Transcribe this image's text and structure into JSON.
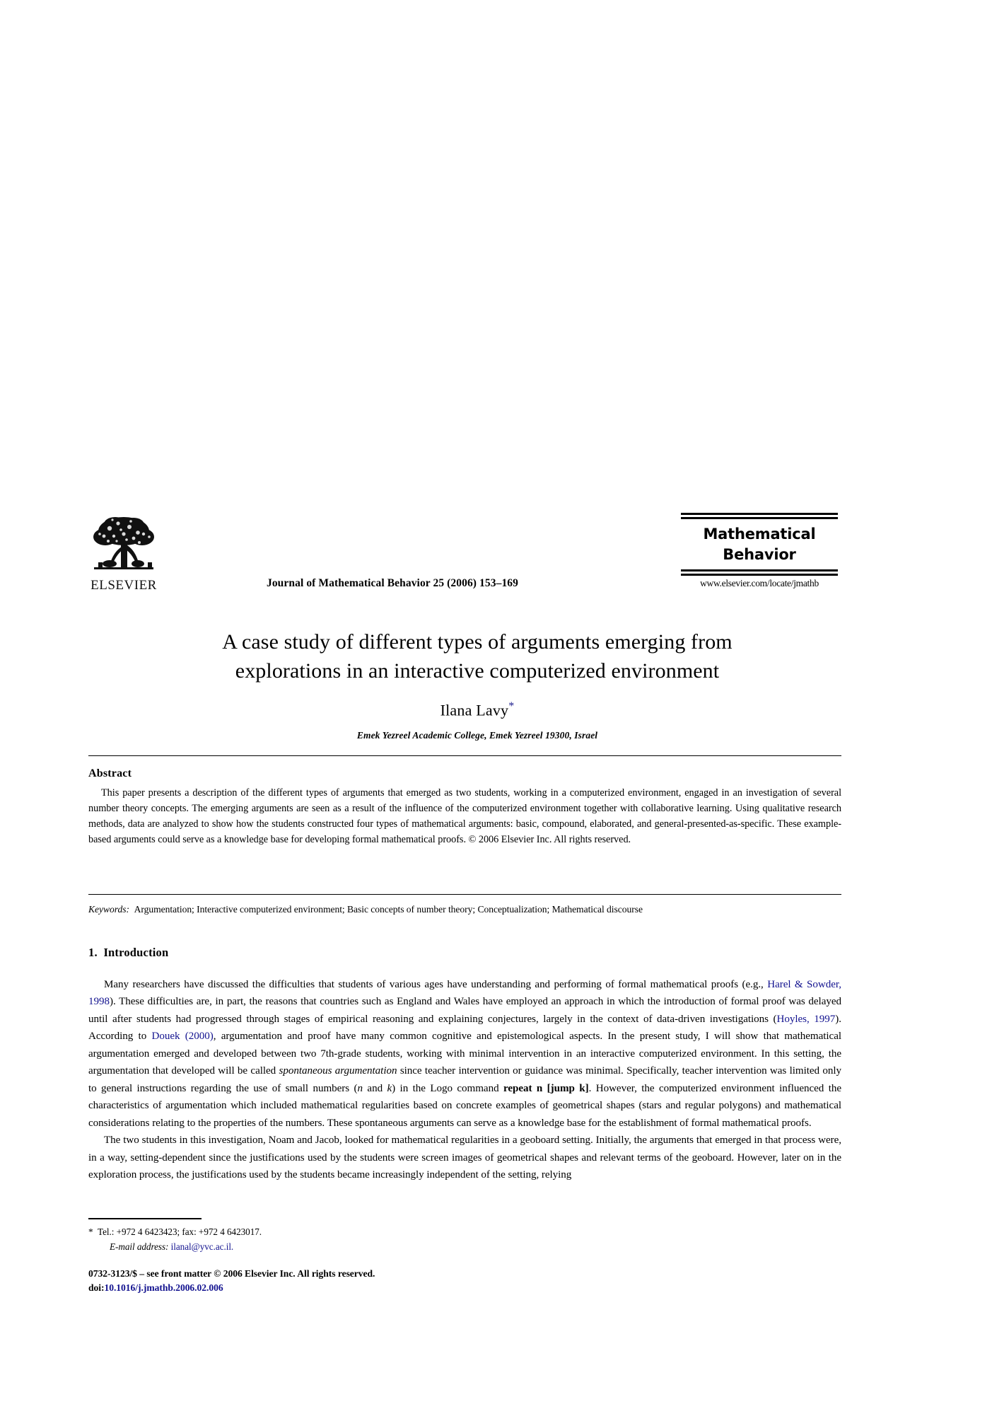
{
  "masthead": {
    "publisher_logo_alt": "ELSEVIER",
    "publisher_name": "ELSEVIER",
    "journal_reference": "Journal of Mathematical Behavior 25 (2006) 153–169",
    "journal_logo_line1": "Mathematical",
    "journal_logo_line2": "Behavior",
    "journal_url": "www.elsevier.com/locate/jmathb"
  },
  "title_block": {
    "title_line1": "A case study of different types of arguments emerging from",
    "title_line2": "explorations in an interactive computerized environment",
    "author": "Ilana Lavy",
    "author_footnote_marker": "*",
    "affiliation": "Emek Yezreel Academic College, Emek Yezreel 19300, Israel"
  },
  "abstract": {
    "heading": "Abstract",
    "text": "This paper presents a description of the different types of arguments that emerged as two students, working in a computerized environment, engaged in an investigation of several number theory concepts. The emerging arguments are seen as a result of the influence of the computerized environment together with collaborative learning. Using qualitative research methods, data are analyzed to show how the students constructed four types of mathematical arguments: basic, compound, elaborated, and general-presented-as-specific. These example-based arguments could serve as a knowledge base for developing formal mathematical proofs.",
    "copyright": "© 2006 Elsevier Inc. All rights reserved."
  },
  "keywords": {
    "label": "Keywords:",
    "list": "Argumentation; Interactive computerized environment; Basic concepts of number theory; Conceptualization; Mathematical discourse"
  },
  "section": {
    "number": "1.",
    "heading": "Introduction",
    "paragraph1": {
      "part1": "Many researchers have discussed the difficulties that students of various ages have understanding and performing of formal mathematical proofs (e.g., ",
      "cite1": "Harel & Sowder, 1998",
      "part2": "). These difficulties are, in part, the reasons that countries such as England and Wales have employed an approach in which the introduction of formal proof was delayed until after students had progressed through stages of empirical reasoning and explaining conjectures, largely in the context of data-driven investigations (",
      "cite2": "Hoyles, 1997",
      "part3": "). According to ",
      "cite3": "Douek (2000)",
      "part4": ", argumentation and proof have many common cognitive and epistemological aspects. In the present study, I will show that mathematical argumentation emerged and developed between two 7th-grade students, working with minimal intervention in an interactive computerized environment. In this setting, the argumentation that developed will be called ",
      "emph1": "spontaneous argumentation",
      "part5": " since teacher intervention or guidance was minimal. Specifically, teacher intervention was limited only to general instructions regarding the use of small numbers (",
      "emph2": "n",
      "part6": " and ",
      "emph3": "k",
      "part7": ") in the Logo command ",
      "strong1": "repeat n [jump k]",
      "part8": ". However, the computerized environment influenced the characteristics of argumentation which included mathematical regularities based on concrete examples of geometrical shapes (stars and regular polygons) and mathematical considerations relating to the properties of the numbers. These spontaneous arguments can serve as a knowledge base for the establishment of formal mathematical proofs."
    },
    "paragraph2": "The two students in this investigation, Noam and Jacob, looked for mathematical regularities in a geoboard setting. Initially, the arguments that emerged in that process were, in a way, setting-dependent since the justifications used by the students were screen images of geometrical shapes and relevant terms of the geoboard. However, later on in the exploration process, the justifications used by the students became increasingly independent of the setting, relying"
  },
  "footnote": {
    "marker": "*",
    "contact": "Tel.: +972 4 6423423; fax: +972 4 6423017.",
    "email_label": "E-mail address:",
    "email": "ilanal@yvc.ac.il."
  },
  "imprint": {
    "issn_line": "0732-3123/$ – see front matter © 2006 Elsevier Inc. All rights reserved.",
    "doi_prefix": "doi:",
    "doi_value": "10.1016/j.jmathb.2006.02.006"
  },
  "colors": {
    "link": "#12128f",
    "text": "#000000",
    "background": "#ffffff"
  }
}
